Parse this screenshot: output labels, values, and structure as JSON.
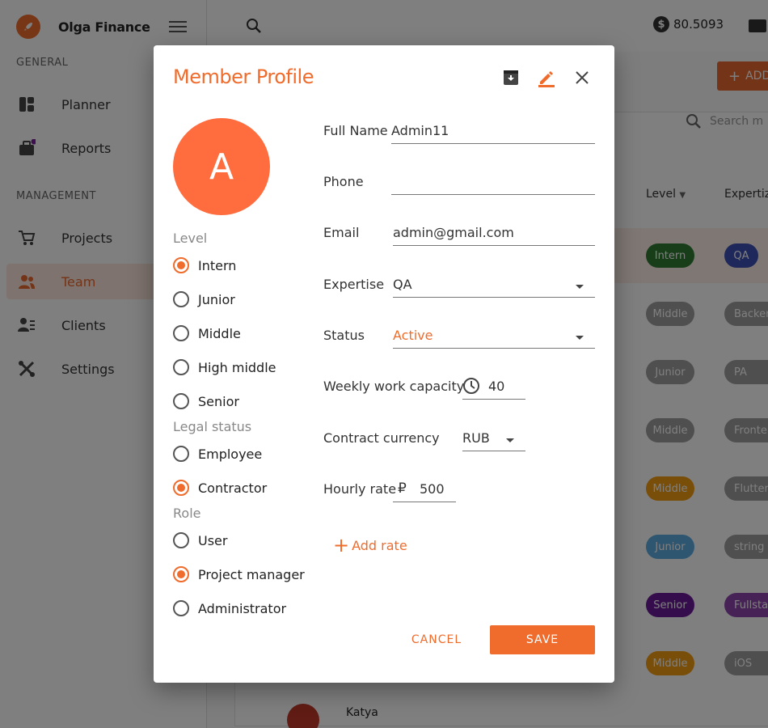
{
  "app": {
    "name": "Olga Finance",
    "sections": {
      "general": "GENERAL",
      "management": "MANAGEMENT"
    },
    "nav": [
      {
        "label": "Planner",
        "icon": "planner-icon"
      },
      {
        "label": "Reports",
        "icon": "reports-icon"
      },
      {
        "label": "Projects",
        "icon": "cart-icon"
      },
      {
        "label": "Team",
        "icon": "team-icon",
        "active": true
      },
      {
        "label": "Clients",
        "icon": "clients-icon"
      },
      {
        "label": "Settings",
        "icon": "tools-icon"
      }
    ],
    "balance": "80.5093",
    "add_label": "ADD",
    "search_placeholder": "Search m",
    "columns": {
      "level": "Level",
      "expertise": "Expertiz"
    },
    "rows": [
      {
        "level": "Intern",
        "level_color": "#2e7d32",
        "expertise": "QA",
        "expertise_color": "#3f51b5"
      },
      {
        "level": "Middle",
        "level_color": "#9e9e9e",
        "expertise": "Backen",
        "expertise_color": "#9e9e9e"
      },
      {
        "level": "Junior",
        "level_color": "#9e9e9e",
        "expertise": "PA",
        "expertise_color": "#9e9e9e"
      },
      {
        "level": "Middle",
        "level_color": "#9e9e9e",
        "expertise": "Fronte",
        "expertise_color": "#9e9e9e"
      },
      {
        "level": "Middle",
        "level_color": "#f39c12",
        "expertise": "Flutter",
        "expertise_color": "#9e9e9e"
      },
      {
        "level": "Junior",
        "level_color": "#5dade2",
        "expertise": "string",
        "expertise_color": "#9e9e9e"
      },
      {
        "level": "Senior",
        "level_color": "#6a1b9a",
        "expertise": "Fullstac",
        "expertise_color": "#8e44ad"
      },
      {
        "level": "Middle",
        "level_color": "#f39c12",
        "expertise": "iOS",
        "expertise_color": "#9e9e9e"
      }
    ],
    "last_person": "Katya"
  },
  "dialog": {
    "title": "Member Profile",
    "avatar_letter": "A",
    "level_label": "Level",
    "levels": [
      "Intern",
      "Junior",
      "Middle",
      "High middle",
      "Senior"
    ],
    "level_selected": 0,
    "legal_label": "Legal status",
    "legal": [
      "Employee",
      "Contractor"
    ],
    "legal_selected": 1,
    "role_label": "Role",
    "roles": [
      "User",
      "Project manager",
      "Administrator"
    ],
    "role_selected": 1,
    "fields": {
      "full_name_label": "Full Name",
      "full_name": "Admin11",
      "phone_label": "Phone",
      "phone": "",
      "email_label": "Email",
      "email": "admin@gmail.com",
      "expertise_label": "Expertise",
      "expertise": "QA",
      "status_label": "Status",
      "status": "Active",
      "capacity_label": "Weekly work capacity",
      "capacity": "40",
      "currency_label": "Contract currency",
      "currency": "RUB",
      "rate_label": "Hourly rate",
      "rate_symbol": "₽",
      "rate": "500"
    },
    "add_rate": "Add rate",
    "cancel": "CANCEL",
    "save": "SAVE"
  }
}
